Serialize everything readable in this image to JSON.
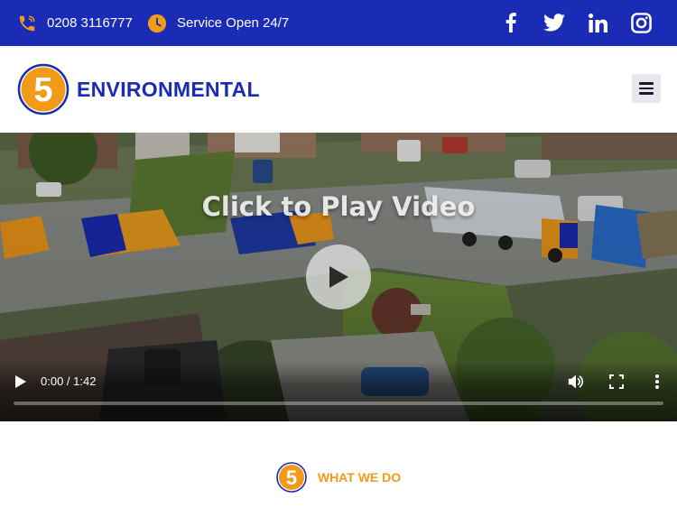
{
  "topbar": {
    "phone": "0208 3116777",
    "hours": "Service Open 24/7",
    "icons": {
      "phone": "phone-icon",
      "clock": "clock-icon"
    },
    "social": [
      "facebook-icon",
      "twitter-icon",
      "linkedin-icon",
      "instagram-icon"
    ]
  },
  "header": {
    "logo_numeral": "5",
    "logo_text": "ENVIRONMENTAL",
    "menu_icon": "hamburger-menu-icon"
  },
  "video": {
    "overlay_title": "Click to Play Video",
    "current_time": "0:00",
    "duration": "1:42",
    "time_display": "0:00 / 1:42",
    "progress": 0
  },
  "section": {
    "badge_numeral": "5",
    "label": "WHAT WE DO"
  },
  "colors": {
    "brand_blue": "#1a2bb5",
    "brand_orange": "#f29a1a",
    "white": "#ffffff"
  }
}
